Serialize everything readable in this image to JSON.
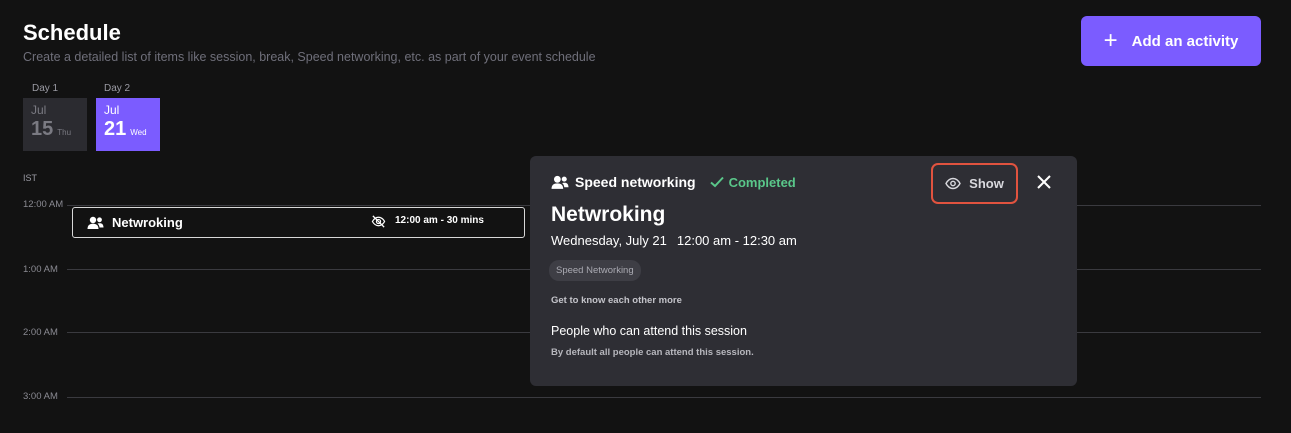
{
  "header": {
    "title": "Schedule",
    "subtitle": "Create a detailed list of items like session, break, Speed networking, etc. as part of your event schedule",
    "add_button": {
      "icon": "plus-icon",
      "label": "Add an activity"
    }
  },
  "days": [
    {
      "label": "Day 1",
      "month": "Jul",
      "date": "15",
      "weekday": "Thu",
      "selected": false
    },
    {
      "label": "Day 2",
      "month": "Jul",
      "date": "21",
      "weekday": "Wed",
      "selected": true
    }
  ],
  "timezone": "IST",
  "time_slots": [
    "12:00 AM",
    "1:00 AM",
    "2:00 AM",
    "3:00 AM"
  ],
  "event": {
    "icon": "people-icon",
    "title": "Netwroking",
    "visibility_icon": "eye-off-icon",
    "time": "12:00 am - 30 mins"
  },
  "popup": {
    "type_icon": "people-icon",
    "type_label": "Speed networking",
    "status_icon": "check-icon",
    "status_label": "Completed",
    "show_button": {
      "icon": "eye-icon",
      "label": "Show"
    },
    "close_icon": "close-icon",
    "title": "Netwroking",
    "date": "Wednesday, July 21",
    "time_range": "12:00 am - 12:30 am",
    "tag": "Speed Networking",
    "description": "Get to know each other more",
    "attendees_title": "People who can attend this session",
    "attendees_note": "By default all people can attend this session."
  },
  "colors": {
    "accent": "#7b5cff",
    "success": "#5ac78a",
    "highlight_border": "#e1533f",
    "background": "#121212",
    "popup_bg": "#2e2e34"
  }
}
